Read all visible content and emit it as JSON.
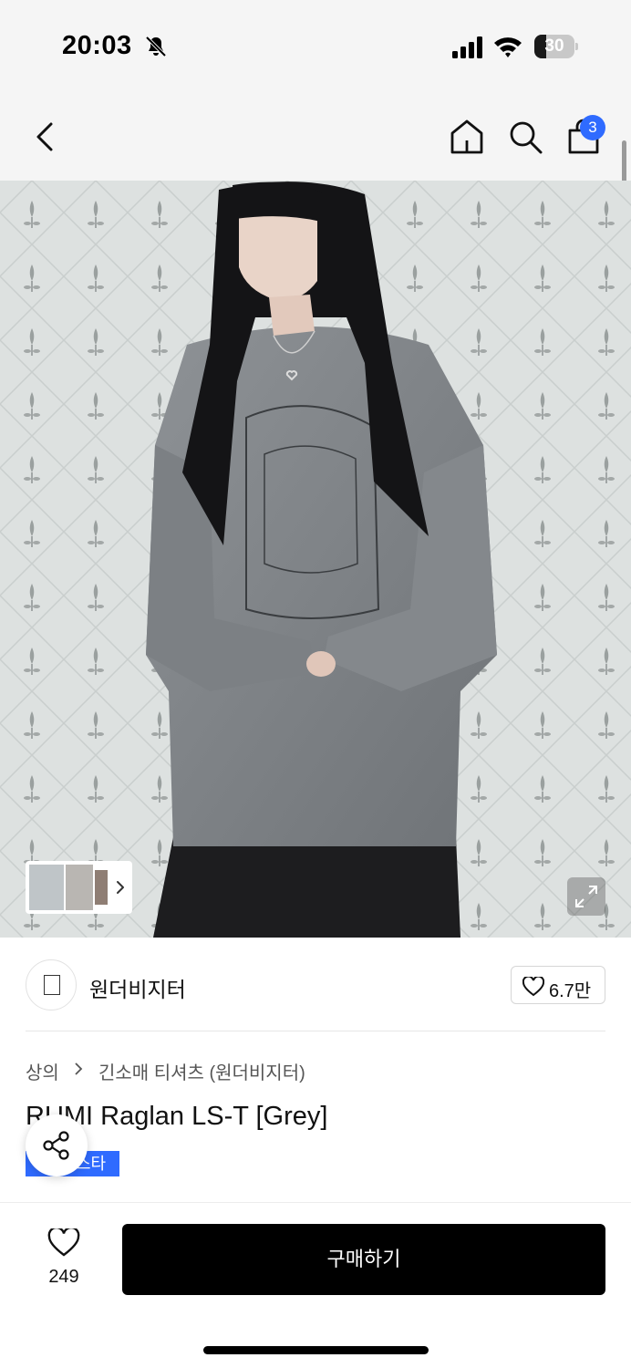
{
  "status_bar": {
    "time": "20:03",
    "battery_level": "30",
    "battery_fraction": 0.3,
    "icons": [
      "bell-slash-icon",
      "cellular-signal-icon",
      "wifi-icon",
      "battery-icon"
    ]
  },
  "nav": {
    "icons": [
      "chevron-left-icon",
      "home-icon",
      "search-icon",
      "shopping-bag-icon"
    ],
    "cart_count": "3"
  },
  "gallery": {
    "icons": [
      "chevron-right-icon",
      "expand-icon"
    ]
  },
  "brand": {
    "name": "원더비지터",
    "likes": "6.7만",
    "icons": [
      "heart-icon"
    ]
  },
  "product": {
    "breadcrumb": [
      "상의",
      "긴소매 티셔츠 (원더비지터)"
    ],
    "title": "RUMI Raglan LS-T [Grey]",
    "tag": "스타",
    "icons": [
      "share-icon"
    ]
  },
  "bottom": {
    "wish_count": "249",
    "buy_label": "구매하기",
    "icons": [
      "heart-icon"
    ]
  },
  "colors": {
    "accent": "#2f6bff",
    "buy_button": "#000000",
    "header_bg": "#f5f5f5"
  }
}
